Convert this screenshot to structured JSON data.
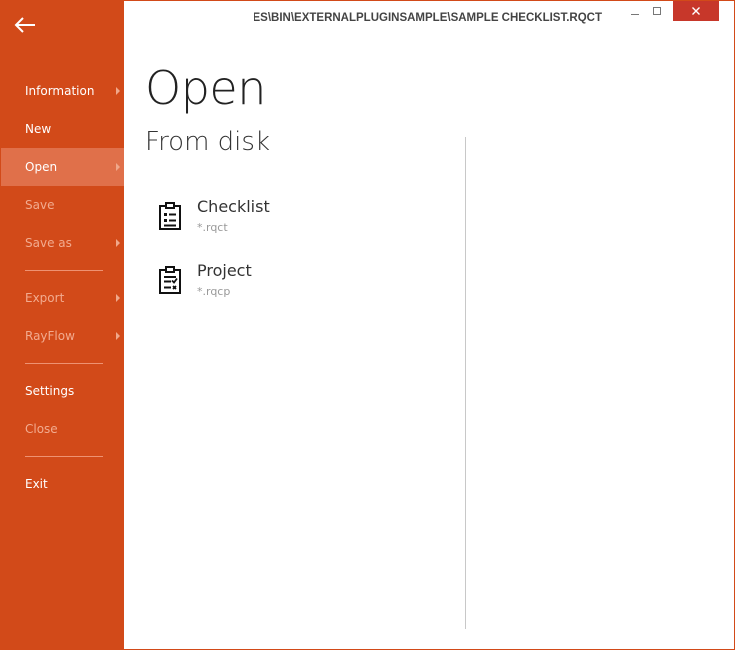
{
  "window": {
    "title": "\\DEVICES\\BIN\\EXTERNALPLUGINSAMPLE\\SAMPLE CHECKLIST.RQCT"
  },
  "sidebar": {
    "items": [
      {
        "label": "Information"
      },
      {
        "label": "New"
      },
      {
        "label": "Open"
      },
      {
        "label": "Save"
      },
      {
        "label": "Save as"
      },
      {
        "label": "Export"
      },
      {
        "label": "RayFlow"
      },
      {
        "label": "Settings"
      },
      {
        "label": "Close"
      },
      {
        "label": "Exit"
      }
    ]
  },
  "main": {
    "title": "Open",
    "section": "From disk",
    "files": [
      {
        "name": "Checklist",
        "ext": "*.rqct",
        "icon": "checklist-icon"
      },
      {
        "name": "Project",
        "ext": "*.rqcp",
        "icon": "project-icon"
      }
    ]
  },
  "colors": {
    "accent": "#d24a19",
    "active": "#e0704a",
    "close": "#c7372a"
  }
}
